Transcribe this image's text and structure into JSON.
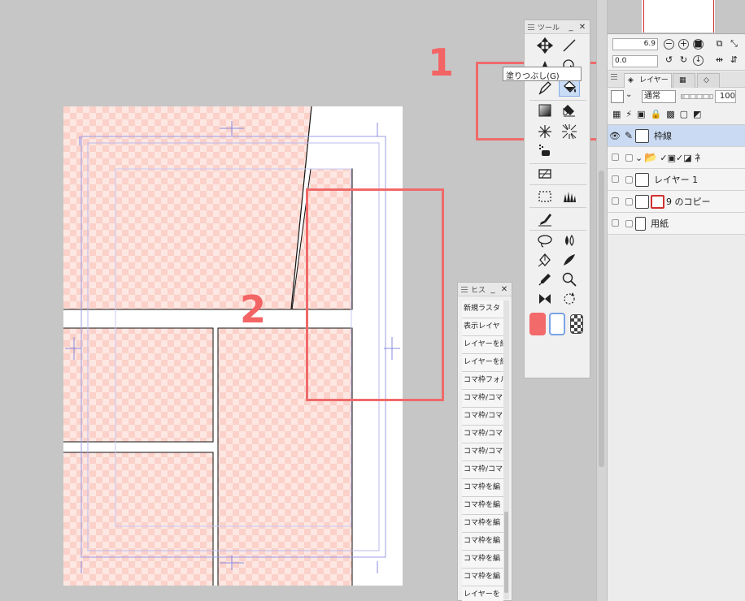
{
  "annotations": {
    "marker1": "1",
    "marker2": "2"
  },
  "tool_panel": {
    "title": "ツール",
    "tooltip": "塗りつぶし(G)",
    "tools": [
      {
        "name": "move-tool",
        "icon": "move-icon"
      },
      {
        "name": "line-tool",
        "icon": "line-icon"
      },
      {
        "name": "transform-tool",
        "icon": "object-select-icon"
      },
      {
        "name": "operation-tool",
        "icon": "cursor-icon"
      },
      {
        "name": "pen-tool",
        "icon": "pen-icon"
      },
      {
        "name": "fill-tool",
        "icon": "paint-bucket-icon",
        "selected": true
      },
      {
        "name": "gradient-tool",
        "icon": "gradient-icon"
      },
      {
        "name": "eraser-tool",
        "icon": "eraser-icon"
      },
      {
        "name": "sparkle-tool",
        "icon": "sparkle-icon"
      },
      {
        "name": "effect-line-tool",
        "icon": "radial-lines-icon"
      }
    ],
    "colors": {
      "main": "#f26a6a",
      "sub": "#ffffff",
      "transparent_label": "transparent"
    }
  },
  "history_panel": {
    "title": "ヒス",
    "items": [
      "新規ラスタ",
      "表示レイヤ",
      "レイヤーを結",
      "レイヤーを結",
      "コマ枠フォル",
      "コマ枠/コマ",
      "コマ枠/コマ",
      "コマ枠/コマ",
      "コマ枠/コマ",
      "コマ枠/コマ",
      "コマ枠を編",
      "コマ枠を編",
      "コマ枠を編",
      "コマ枠を編",
      "コマ枠を編",
      "コマ枠を編",
      "レイヤーを"
    ]
  },
  "navigator": {
    "zoom": "6.9",
    "angle": "0.0"
  },
  "layer_panel": {
    "tab_layer": "レイヤー",
    "blend_mode": "通常",
    "opacity": "100",
    "layers": [
      {
        "name": "枠線",
        "active": true,
        "visible": true
      },
      {
        "name": "",
        "folder": true
      },
      {
        "name": "レイヤー 1"
      },
      {
        "name": "9 のコピー"
      },
      {
        "name": "用紙"
      }
    ]
  }
}
